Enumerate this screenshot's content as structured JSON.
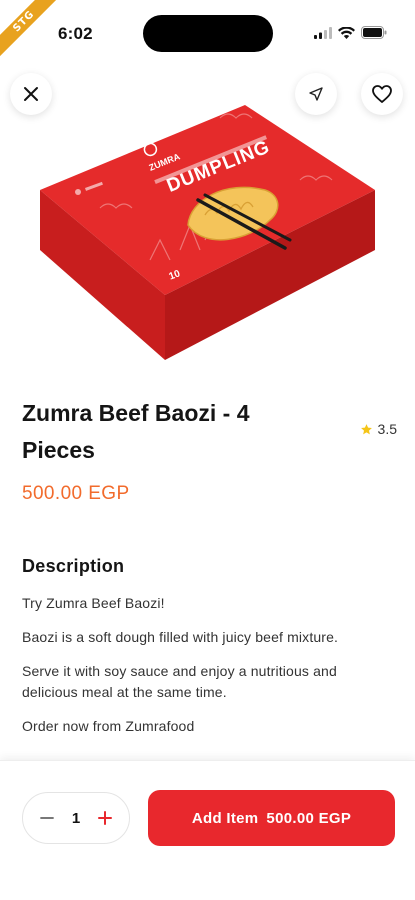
{
  "status": {
    "time": "6:02",
    "ribbon": "STG"
  },
  "product": {
    "title": "Zumra Beef Baozi - 4 Pieces",
    "rating": "3.5",
    "price": "500.00 EGP",
    "box_brand": "ZUMRA",
    "box_label": "DUMPLING",
    "box_count": "10"
  },
  "description": {
    "heading": "Description",
    "paragraphs": [
      "Try Zumra Beef Baozi!",
      "Baozi is a soft dough filled with juicy beef mixture.",
      "Serve it with soy sauce and enjoy a nutritious and delicious meal at the same time.",
      "Order now from Zumrafood"
    ]
  },
  "cart": {
    "quantity": "1",
    "add_label": "Add Item",
    "add_price": "500.00 EGP"
  },
  "colors": {
    "accent": "#e8282d",
    "price": "#f26b2c",
    "star": "#f5c518"
  }
}
